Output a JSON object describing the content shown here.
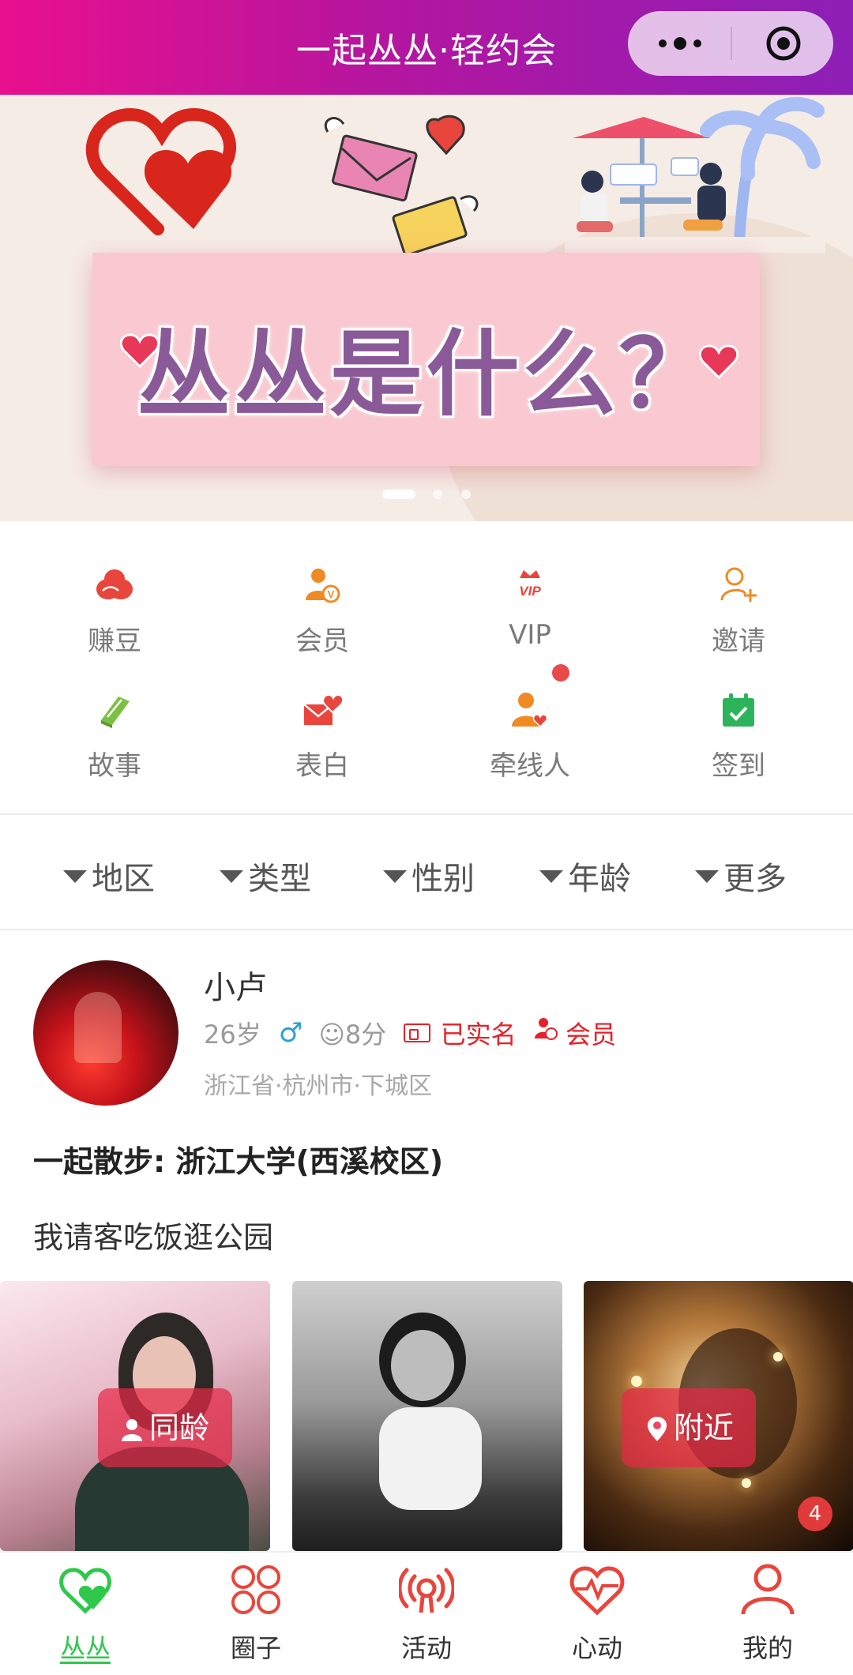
{
  "header": {
    "title": "一起丛丛·轻约会",
    "more_icon": "more-dots-icon",
    "close_icon": "target-circle-icon"
  },
  "banner": {
    "headline": "丛丛是什么？",
    "slides": 3,
    "active_slide": 1
  },
  "menu": [
    {
      "label": "赚豆",
      "icon": "beans-icon",
      "color": "#e8453c"
    },
    {
      "label": "会员",
      "icon": "member-icon",
      "color": "#f08a24"
    },
    {
      "label": "VIP",
      "icon": "vip-crown-icon",
      "color": "#e8453c"
    },
    {
      "label": "邀请",
      "icon": "add-user-icon",
      "color": "#f08a24"
    },
    {
      "label": "故事",
      "icon": "book-icon",
      "color": "#7cc043"
    },
    {
      "label": "表白",
      "icon": "love-letter-icon",
      "color": "#e8453c"
    },
    {
      "label": "牵线人",
      "icon": "matchmaker-icon",
      "color": "#f08a24"
    },
    {
      "label": "签到",
      "icon": "calendar-check-icon",
      "color": "#2db35b"
    }
  ],
  "filters": [
    "地区",
    "类型",
    "性别",
    "年龄",
    "更多"
  ],
  "profile": {
    "name": "小卢",
    "age": "26岁",
    "gender_symbol": "♂",
    "score": "☺8分",
    "verified": "已实名",
    "member": "会员",
    "location": "浙江省·杭州市·下城区"
  },
  "post": {
    "title": "一起散步: 浙江大学(西溪校区)",
    "description": "我请客吃饭逛公园"
  },
  "photo_overlays": {
    "same_age": "同龄",
    "nearby": "附近",
    "count": "4"
  },
  "tabs": [
    {
      "label": "丛丛",
      "icon": "heart-icon",
      "active": true
    },
    {
      "label": "圈子",
      "icon": "circles-icon",
      "active": false
    },
    {
      "label": "活动",
      "icon": "broadcast-icon",
      "active": false
    },
    {
      "label": "心动",
      "icon": "heartbeat-icon",
      "active": false
    },
    {
      "label": "我的",
      "icon": "user-icon",
      "active": false
    }
  ],
  "colors": {
    "accent": "#e62028",
    "active_tab": "#2ec84a",
    "header_start": "#e8108e",
    "header_end": "#8d1fb6"
  }
}
